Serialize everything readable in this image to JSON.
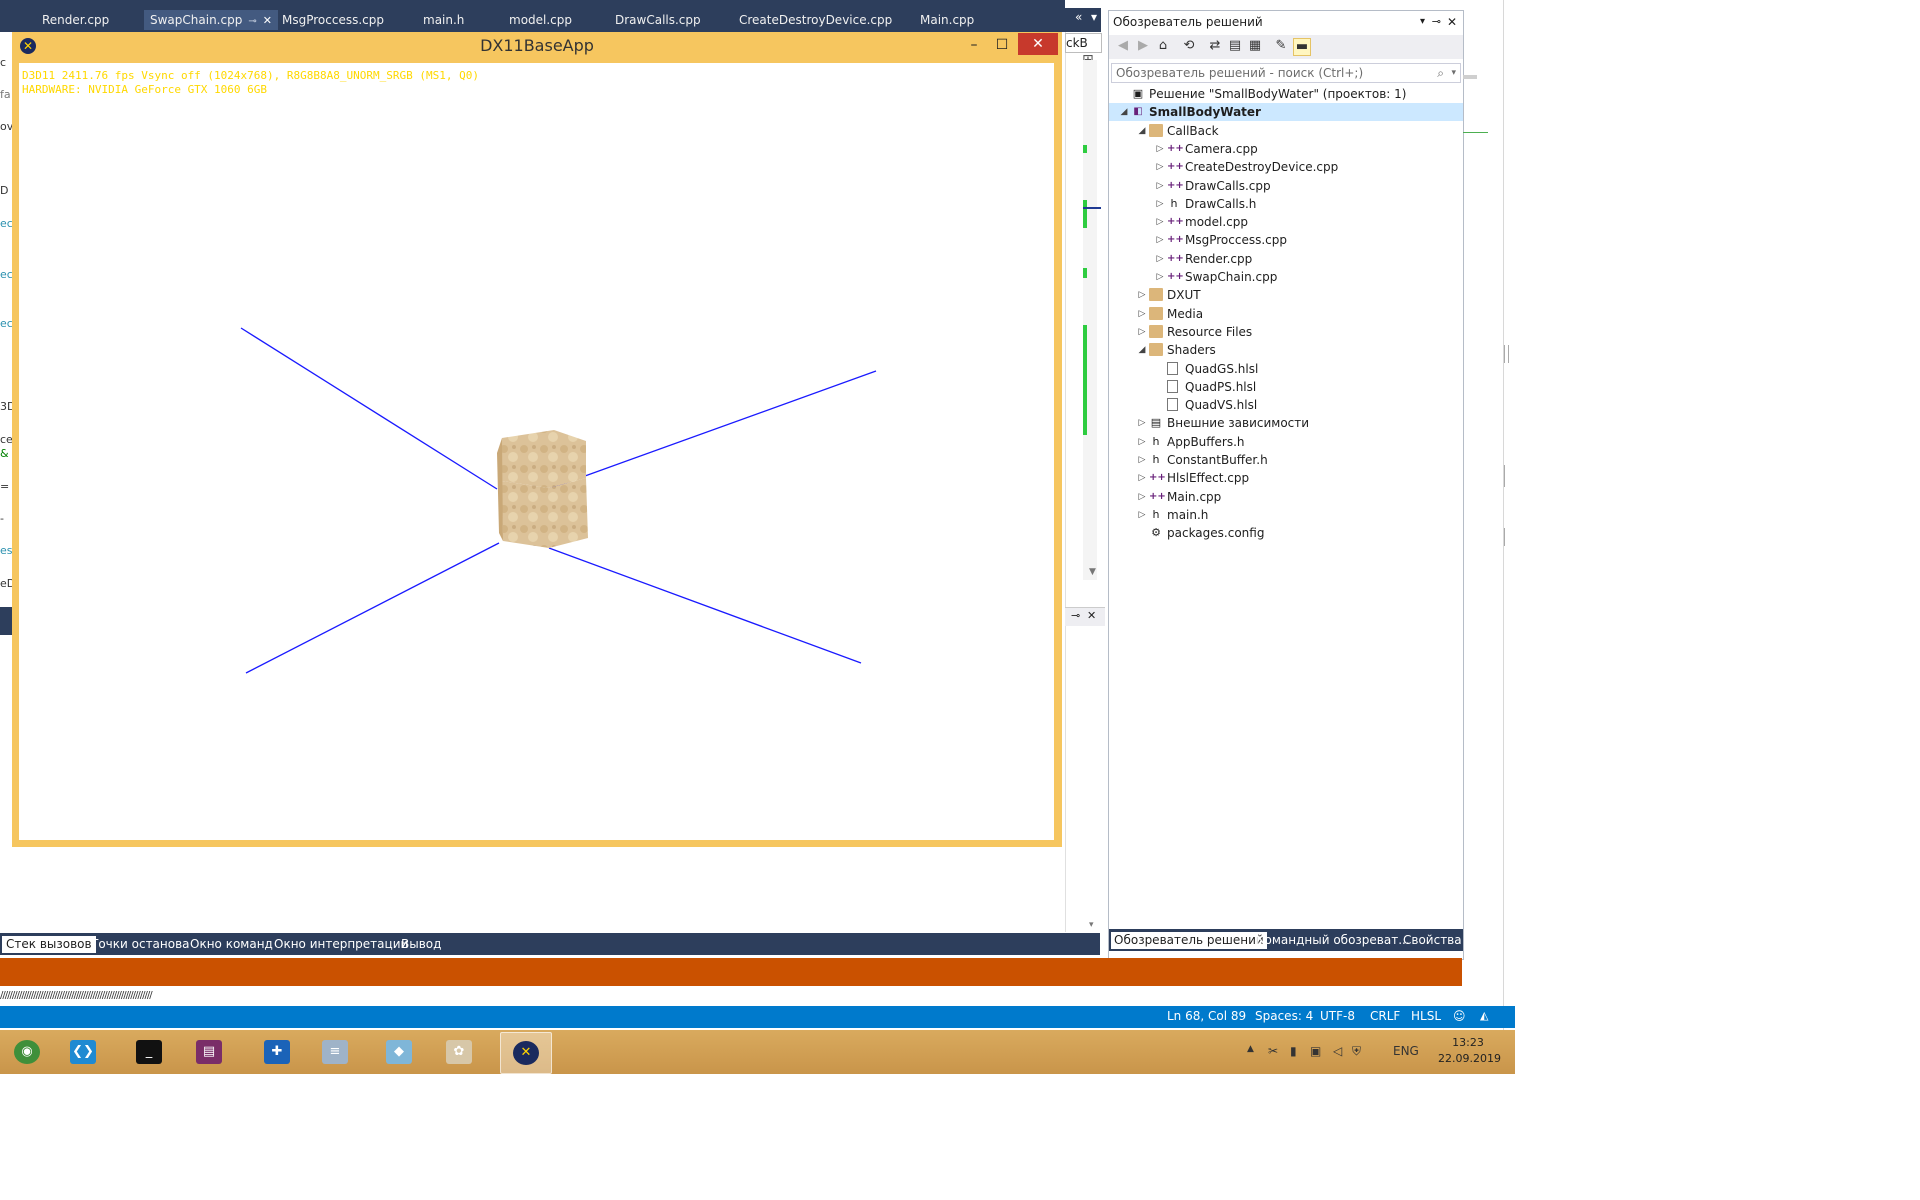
{
  "doc_tabs": [
    {
      "label": "Render.cpp",
      "active": false
    },
    {
      "label": "SwapChain.cpp",
      "active": true
    },
    {
      "label": "MsgProccess.cpp",
      "active": false
    },
    {
      "label": "main.h",
      "active": false
    },
    {
      "label": "model.cpp",
      "active": false
    },
    {
      "label": "DrawCalls.cpp",
      "active": false
    },
    {
      "label": "CreateDestroyDevice.cpp",
      "active": false
    },
    {
      "label": "Main.cpp",
      "active": false
    }
  ],
  "tab_tools": {
    "overflow": "«",
    "dropdown": "▾"
  },
  "mid_combo": "ckB",
  "left_fragments": [
    "c",
    "fa",
    "ov",
    "D",
    "ec",
    "ec",
    "ec",
    "3D",
    "ce",
    "&",
    "=",
    "-",
    "es",
    "eD"
  ],
  "dx_window": {
    "title": "DX11BaseApp",
    "hud_line1": "D3D11 2411.76 fps Vsync off (1024x768), R8G8B8A8_UNORM_SRGB (MS1, Q0)",
    "hud_line2": "HARDWARE: NVIDIA GeForce GTX 1060 6GB",
    "min": "–",
    "max": "☐",
    "close": "✕"
  },
  "solution_explorer": {
    "title": "Обозреватель решений",
    "search_placeholder": "Обозреватель решений - поиск (Ctrl+;)",
    "items": [
      {
        "label": "Решение \"SmallBodyWater\"  (проектов: 1)",
        "depth": 0,
        "arrow": "",
        "icon": "solution"
      },
      {
        "label": "SmallBodyWater",
        "depth": 0,
        "arrow": "◢",
        "icon": "project",
        "selected": true
      },
      {
        "label": "CallBack",
        "depth": 1,
        "arrow": "◢",
        "icon": "folder"
      },
      {
        "label": "Camera.cpp",
        "depth": 2,
        "arrow": "▷",
        "icon": "cpp"
      },
      {
        "label": "CreateDestroyDevice.cpp",
        "depth": 2,
        "arrow": "▷",
        "icon": "cpp"
      },
      {
        "label": "DrawCalls.cpp",
        "depth": 2,
        "arrow": "▷",
        "icon": "cpp"
      },
      {
        "label": "DrawCalls.h",
        "depth": 2,
        "arrow": "▷",
        "icon": "h"
      },
      {
        "label": "model.cpp",
        "depth": 2,
        "arrow": "▷",
        "icon": "cpp"
      },
      {
        "label": "MsgProccess.cpp",
        "depth": 2,
        "arrow": "▷",
        "icon": "cpp"
      },
      {
        "label": "Render.cpp",
        "depth": 2,
        "arrow": "▷",
        "icon": "cpp"
      },
      {
        "label": "SwapChain.cpp",
        "depth": 2,
        "arrow": "▷",
        "icon": "cpp"
      },
      {
        "label": "DXUT",
        "depth": 1,
        "arrow": "▷",
        "icon": "folder"
      },
      {
        "label": "Media",
        "depth": 1,
        "arrow": "▷",
        "icon": "folder"
      },
      {
        "label": "Resource Files",
        "depth": 1,
        "arrow": "▷",
        "icon": "folder"
      },
      {
        "label": "Shaders",
        "depth": 1,
        "arrow": "◢",
        "icon": "folder-open"
      },
      {
        "label": "QuadGS.hlsl",
        "depth": 2,
        "arrow": "",
        "icon": "file"
      },
      {
        "label": "QuadPS.hlsl",
        "depth": 2,
        "arrow": "",
        "icon": "file"
      },
      {
        "label": "QuadVS.hlsl",
        "depth": 2,
        "arrow": "",
        "icon": "file"
      },
      {
        "label": "Внешние зависимости",
        "depth": 1,
        "arrow": "▷",
        "icon": "deps"
      },
      {
        "label": "AppBuffers.h",
        "depth": 1,
        "arrow": "▷",
        "icon": "h"
      },
      {
        "label": "ConstantBuffer.h",
        "depth": 1,
        "arrow": "▷",
        "icon": "h"
      },
      {
        "label": "HlslEffect.cpp",
        "depth": 1,
        "arrow": "▷",
        "icon": "cpp"
      },
      {
        "label": "Main.cpp",
        "depth": 1,
        "arrow": "▷",
        "icon": "cpp"
      },
      {
        "label": "main.h",
        "depth": 1,
        "arrow": "▷",
        "icon": "h"
      },
      {
        "label": "packages.config",
        "depth": 1,
        "arrow": "",
        "icon": "config"
      }
    ],
    "bottom_tabs": [
      "Обозреватель решений",
      "Командный обозреват...",
      "Свойства"
    ]
  },
  "bottom_tabs": [
    "Стек вызовов",
    "Точки останова",
    "Окно команд",
    "Окно интерпретации",
    "Вывод"
  ],
  "dashes": "////////////////////////////////////////////////////////////////",
  "status": {
    "position": "Ln 68, Col 89",
    "spaces": "Spaces: 4",
    "encoding": "UTF-8",
    "eol": "CRLF",
    "language": "HLSL",
    "smiley": "☺",
    "bell": "🔔"
  },
  "taskbar": {
    "apps": [
      "network-app",
      "vscode",
      "terminal",
      "winrar",
      "defender",
      "paint-stack",
      "notepad",
      "art",
      "dx11-app"
    ],
    "lang": "ENG",
    "time": "13:23",
    "date": "22.09.2019",
    "tray_up": "▲"
  },
  "colors": {
    "vs_dark": "#2d3e5c",
    "dx_frame": "#f6c65f",
    "orange_bar": "#ca5100",
    "status_blue": "#007acc",
    "axis_blue": "#1a1aff",
    "hud_yellow": "#ffd800",
    "cube": "#d9bd92"
  }
}
